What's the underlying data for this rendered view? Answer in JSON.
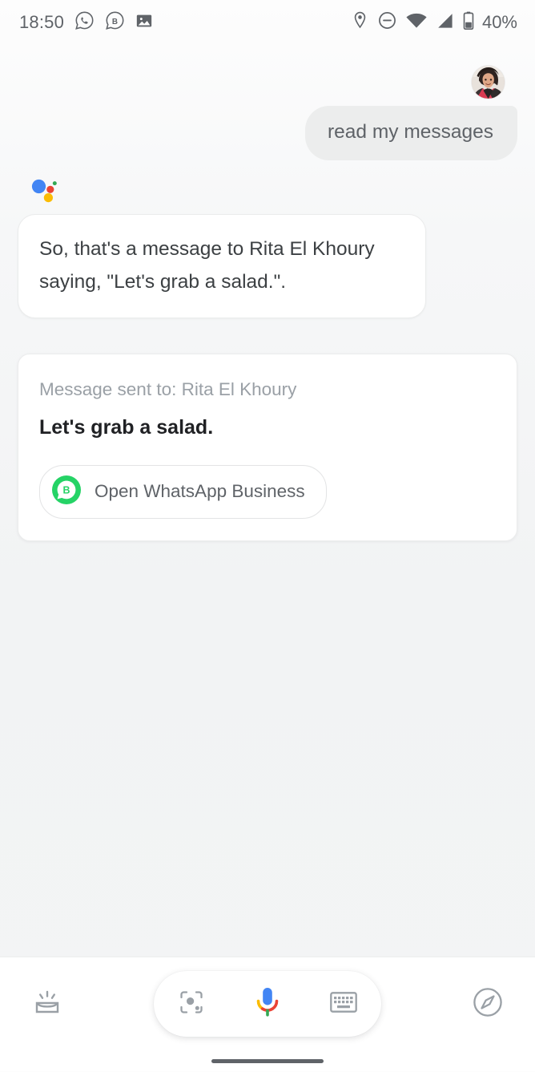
{
  "status_bar": {
    "clock": "18:50",
    "left_icons": [
      "whatsapp-icon",
      "whatsapp-business-icon",
      "screenshot-image-icon"
    ],
    "right_icons": [
      "location-pin-icon",
      "do-not-disturb-icon",
      "wifi-icon",
      "cellular-signal-icon",
      "battery-icon"
    ],
    "battery_percent": "40%",
    "icon_color": "#5f6368"
  },
  "conversation": {
    "user": {
      "avatar_name": "user-avatar-photo",
      "message": "read my messages",
      "bubble_color": "#eceded",
      "text_color": "#5f6368"
    },
    "assistant": {
      "logo_name": "google-assistant-logo",
      "logo_colors": {
        "blue": "#4285f4",
        "red": "#ea4335",
        "yellow": "#fbbc04",
        "green": "#34a853"
      },
      "response": "So, that's a message to Rita El Khoury saying, \"Let's grab a salad.\"."
    },
    "result_card": {
      "subtitle": "Message sent to: Rita El Khoury",
      "message_body": "Let's grab a salad.",
      "action_button": {
        "label": "Open WhatsApp Business",
        "icon_name": "whatsapp-business-icon",
        "icon_color": "#25d366"
      }
    }
  },
  "bottom_bar": {
    "snapshot_label": "snapshot-icon",
    "lens_label": "google-lens-icon",
    "mic_label": "google-mic-icon",
    "keyboard_label": "keyboard-icon",
    "explore_label": "explore-compass-icon",
    "mic_colors": {
      "blue": "#4285f4",
      "red": "#ea4335",
      "yellow": "#fbbc04",
      "green": "#34a853"
    },
    "icon_color": "#9aa0a6",
    "home_indicator_color": "#5f6368"
  }
}
